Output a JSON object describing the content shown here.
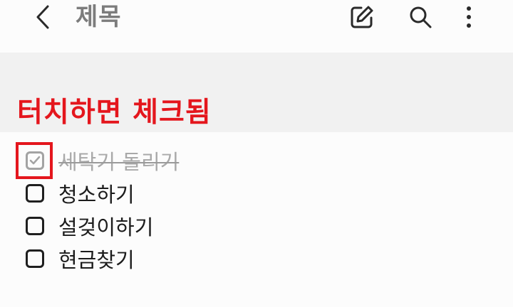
{
  "toolbar": {
    "title": "제목",
    "icons": [
      "chevron-left-icon",
      "edit-icon",
      "search-icon",
      "more-vertical-icon"
    ]
  },
  "annotation": {
    "text": "터치하면 체크됨",
    "color": "#e4161d"
  },
  "checklist": {
    "items": [
      {
        "label": "세탁기 돌리기",
        "checked": true
      },
      {
        "label": "청소하기",
        "checked": false
      },
      {
        "label": "설겆이하기",
        "checked": false
      },
      {
        "label": "현금찾기",
        "checked": false
      }
    ]
  }
}
